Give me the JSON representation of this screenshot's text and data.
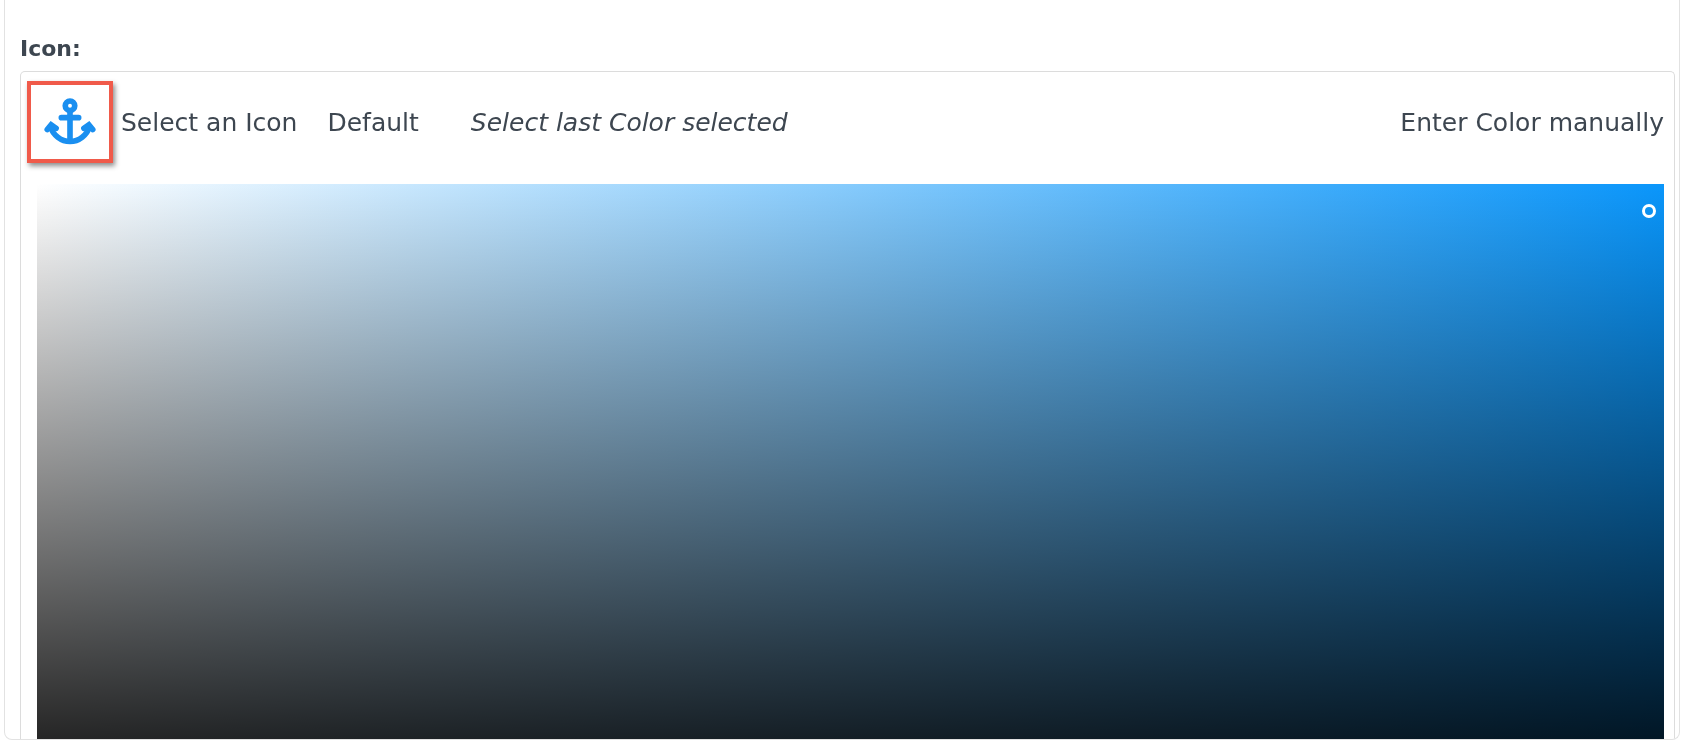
{
  "field": {
    "label": "Icon:"
  },
  "icon_button": {
    "highlighted": true
  },
  "toolbar": [
    {
      "label": "Select an Icon",
      "emphasized": false
    },
    {
      "label": "Default",
      "emphasized": false
    },
    {
      "label": "Select last Color selected",
      "emphasized": true
    }
  ],
  "manual_entry": {
    "label": "Enter Color manually"
  },
  "color_picker": {
    "color": "#0a96fb"
  }
}
